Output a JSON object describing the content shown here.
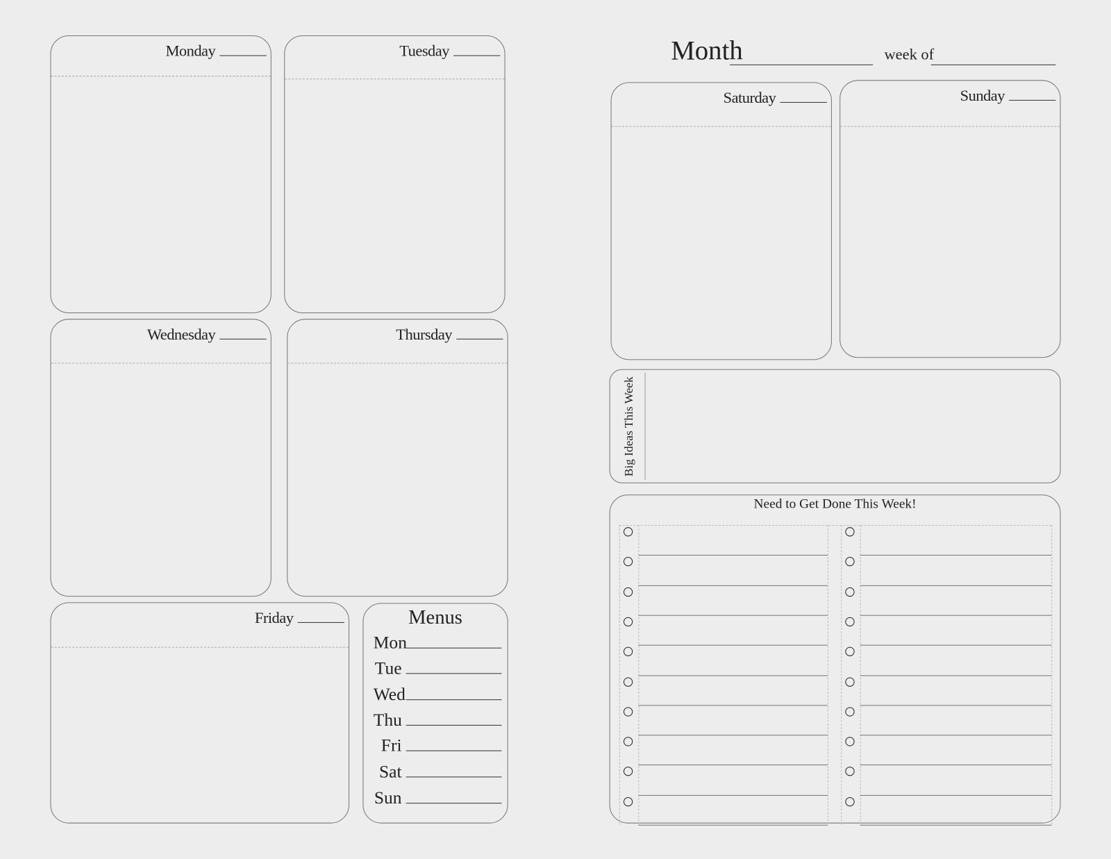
{
  "days": {
    "monday": "Monday",
    "tuesday": "Tuesday",
    "wednesday": "Wednesday",
    "thursday": "Thursday",
    "friday": "Friday",
    "saturday": "Saturday",
    "sunday": "Sunday"
  },
  "menus": {
    "title": "Menus",
    "rows": [
      "Mon",
      "Tue",
      "Wed",
      "Thu",
      "Fri",
      "Sat",
      "Sun"
    ]
  },
  "header": {
    "month_label": "Month",
    "week_of_label": "week of"
  },
  "big_ideas": {
    "label": "Big Ideas This Week"
  },
  "todo": {
    "title": "Need to Get Done This Week!",
    "rows_per_column": 10,
    "columns": 2
  }
}
